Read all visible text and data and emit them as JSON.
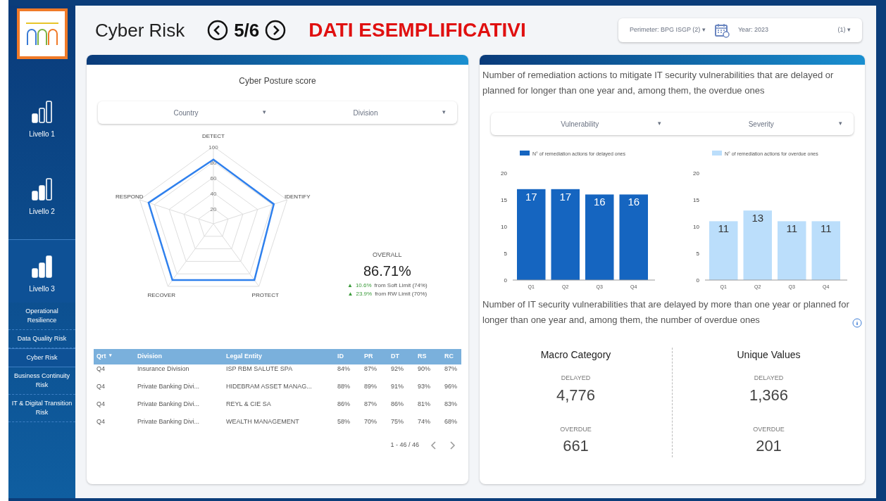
{
  "sidebar": {
    "levels": [
      {
        "label": "Livello 1",
        "selected": false
      },
      {
        "label": "Livello 2",
        "selected": false
      },
      {
        "label": "Livello 3",
        "selected": true
      }
    ],
    "items": [
      {
        "label": "Operational Resilience",
        "selected": false
      },
      {
        "label": "Data Quality Risk",
        "selected": false
      },
      {
        "label": "Cyber Risk",
        "selected": true
      },
      {
        "label": "Business Continuity Risk",
        "selected": false
      },
      {
        "label": "IT & Digital Transition Risk",
        "selected": false
      }
    ]
  },
  "header": {
    "title": "Cyber Risk",
    "page": "5/6",
    "banner": "DATI ESEMPLIFICATIVI",
    "filters": {
      "perimeter": "Perimeter: BPG ISGP (2)",
      "perimeter_caret": "▾",
      "year": "Year: 2023",
      "year_count": "(1)",
      "year_caret": "▾"
    }
  },
  "posture": {
    "title": "Cyber Posture score",
    "dropdowns": [
      {
        "label": "Country",
        "caret": "▾"
      },
      {
        "label": "Division",
        "caret": "▾"
      }
    ],
    "radar": {
      "ticks": [
        "100",
        "80",
        "60",
        "40",
        "20"
      ],
      "axes": [
        "DETECT",
        "IDENTIFY",
        "PROTECT",
        "RECOVER",
        "RESPOND"
      ]
    },
    "overall": {
      "label": "OVERALL",
      "value": "86.71%",
      "deltas": [
        {
          "arrow": "▲",
          "value": "10.6%",
          "text": "from Soft Limit (74%)"
        },
        {
          "arrow": "▲",
          "value": "23.9%",
          "text": "from RW Limit (70%)"
        }
      ]
    },
    "table": {
      "columns": [
        "Qrt",
        "Division",
        "Legal Entity",
        "ID",
        "PR",
        "DT",
        "RS",
        "RC"
      ],
      "sort_mark": "▾",
      "rows": [
        [
          "Q4",
          "Insurance Division",
          "ISP RBM SALUTE SPA",
          "84%",
          "87%",
          "92%",
          "90%",
          "87%"
        ],
        [
          "Q4",
          "Private Banking Divi...",
          "HIDEBRAM ASSET MANAG...",
          "88%",
          "89%",
          "91%",
          "93%",
          "96%"
        ],
        [
          "Q4",
          "Private Banking Divi...",
          "REYL & CIE SA",
          "86%",
          "87%",
          "86%",
          "81%",
          "83%"
        ],
        [
          "Q4",
          "Private Banking Divi...",
          "WEALTH MANAGEMENT",
          "58%",
          "70%",
          "75%",
          "74%",
          "68%"
        ]
      ],
      "pagination": "1 - 46 / 46"
    }
  },
  "remediation": {
    "title": "Number of remediation actions to mitigate IT security vulnerabilities that are delayed or planned for longer than one year and, among them, the overdue ones",
    "dropdowns": [
      {
        "label": "Vulnerability",
        "caret": "▾"
      },
      {
        "label": "Severity",
        "caret": "▾"
      }
    ],
    "charts": [
      {
        "chart_data": {
          "type": "bar",
          "categories": [
            "Q1",
            "Q2",
            "Q3",
            "Q4"
          ],
          "series": [
            {
              "name": "N° of remediation actions for delayed ones",
              "color": "#1565c0",
              "values": [
                17,
                17,
                16,
                16
              ]
            }
          ],
          "ylim": [
            0,
            20
          ],
          "yticks": [
            0,
            5,
            10,
            15,
            20
          ],
          "data_labels": true
        }
      },
      {
        "chart_data": {
          "type": "bar",
          "categories": [
            "Q1",
            "Q2",
            "Q3",
            "Q4"
          ],
          "series": [
            {
              "name": "N° of remediation actions for overdue ones",
              "color": "#bbdefb",
              "values": [
                11,
                13,
                11,
                11
              ]
            }
          ],
          "ylim": [
            0,
            20
          ],
          "yticks": [
            0,
            5,
            10,
            15,
            20
          ],
          "data_labels": true
        }
      }
    ],
    "subtitle": "Number of IT security vulnerabilities that are delayed by more than one year or planned for longer than one year and, among them, the number of overdue ones",
    "kpis": [
      {
        "title": "Macro Category",
        "delayed_label": "DELAYED",
        "delayed": "4,776",
        "overdue_label": "OVERDUE",
        "overdue": "661"
      },
      {
        "title": "Unique Values",
        "delayed_label": "DELAYED",
        "delayed": "1,366",
        "overdue_label": "OVERDUE",
        "overdue": "201"
      }
    ]
  }
}
